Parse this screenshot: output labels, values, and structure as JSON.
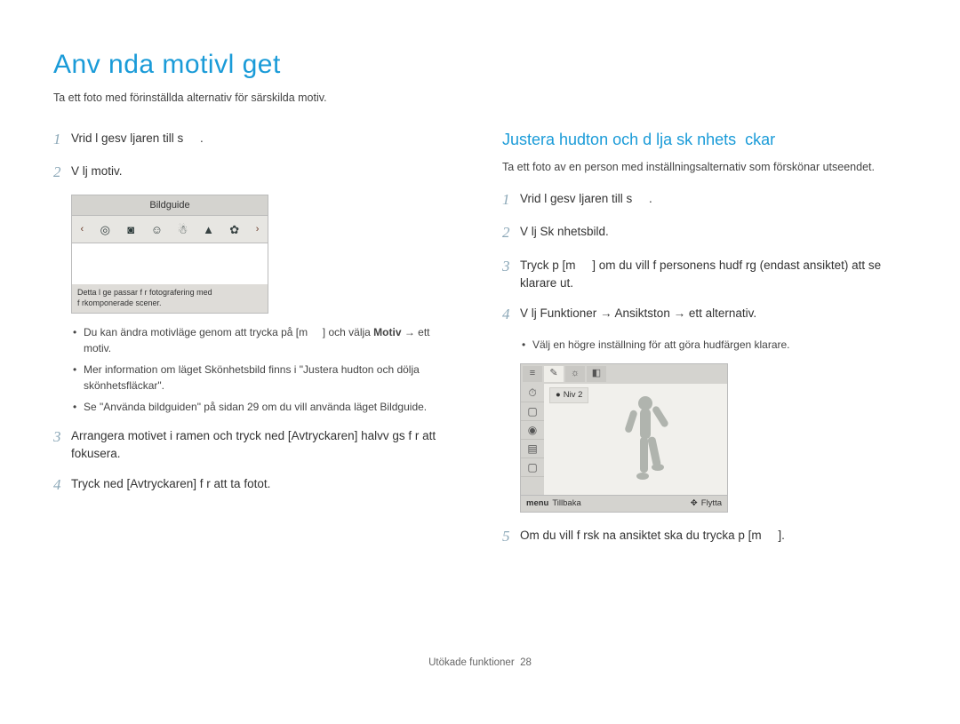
{
  "title": "Anv nda motivl get",
  "intro": "Ta ett foto med förinställda alternativ för särskilda motiv.",
  "left": {
    "steps": {
      "s1": {
        "num": "1",
        "text": "Vrid l gesv ljaren till s     ."
      },
      "s2": {
        "num": "2",
        "text": "V lj motiv."
      },
      "s3": {
        "num": "3",
        "text": "Arrangera motivet i ramen och tryck ned [Avtryckaren] halvv gs f r att fokusera."
      },
      "s4": {
        "num": "4",
        "text": "Tryck ned [Avtryckaren] f r att ta fotot."
      }
    },
    "bullets": {
      "b1_a": "Du kan ändra motivläge genom att trycka på [m     ] och välja ",
      "b1_b": "Motiv",
      "b1_c": " → ett motiv.",
      "b2": "Mer information om läget Skönhetsbild finns i \"Justera hudton och dölja skönhetsfläckar\".",
      "b3": "Se \"Använda bildguiden\" på sidan 29 om du vill använda läget Bildguide."
    }
  },
  "screen1": {
    "title": "Bildguide",
    "desc1": "Detta l ge passar f r fotografering med",
    "desc2": "f rkomponerade scener."
  },
  "right": {
    "heading": "Justera hudton och d lja sk nhets  ckar",
    "intro": "Ta ett foto av en person med inställningsalternativ som förskönar utseendet.",
    "steps": {
      "s1": {
        "num": "1",
        "text": "Vrid l gesv ljaren till s     ."
      },
      "s2": {
        "num": "2",
        "text": "V lj Sk nhetsbild."
      },
      "s3": {
        "num": "3",
        "text": "Tryck p  [m     ] om du vill f  personens hudf rg (endast ansiktet) att se klarare ut."
      },
      "s4": {
        "num": "4",
        "text": "V lj Funktioner → Ansiktston → ett alternativ."
      },
      "s5": {
        "num": "5",
        "text": "Om du vill f rsk na ansiktet ska du trycka p  [m     ]."
      }
    },
    "bullets": {
      "b1": "Välj en högre inställning för att göra hudfärgen klarare."
    }
  },
  "screen2": {
    "level_label": "Niv  2",
    "back": "Tillbaka",
    "move": "Flytta",
    "menu_label": "menu"
  },
  "footer": {
    "section": "Utökade funktioner",
    "page": "28"
  },
  "icons": {
    "target": "◎",
    "camera": "◙",
    "portrait": "☺",
    "person": "☃",
    "mountain": "▲",
    "flower": "✿",
    "chev_left": "‹",
    "chev_right": "›",
    "nav": "✥",
    "alarm": "⏱",
    "square": "▢",
    "stack": "▤",
    "disc": "◉"
  }
}
